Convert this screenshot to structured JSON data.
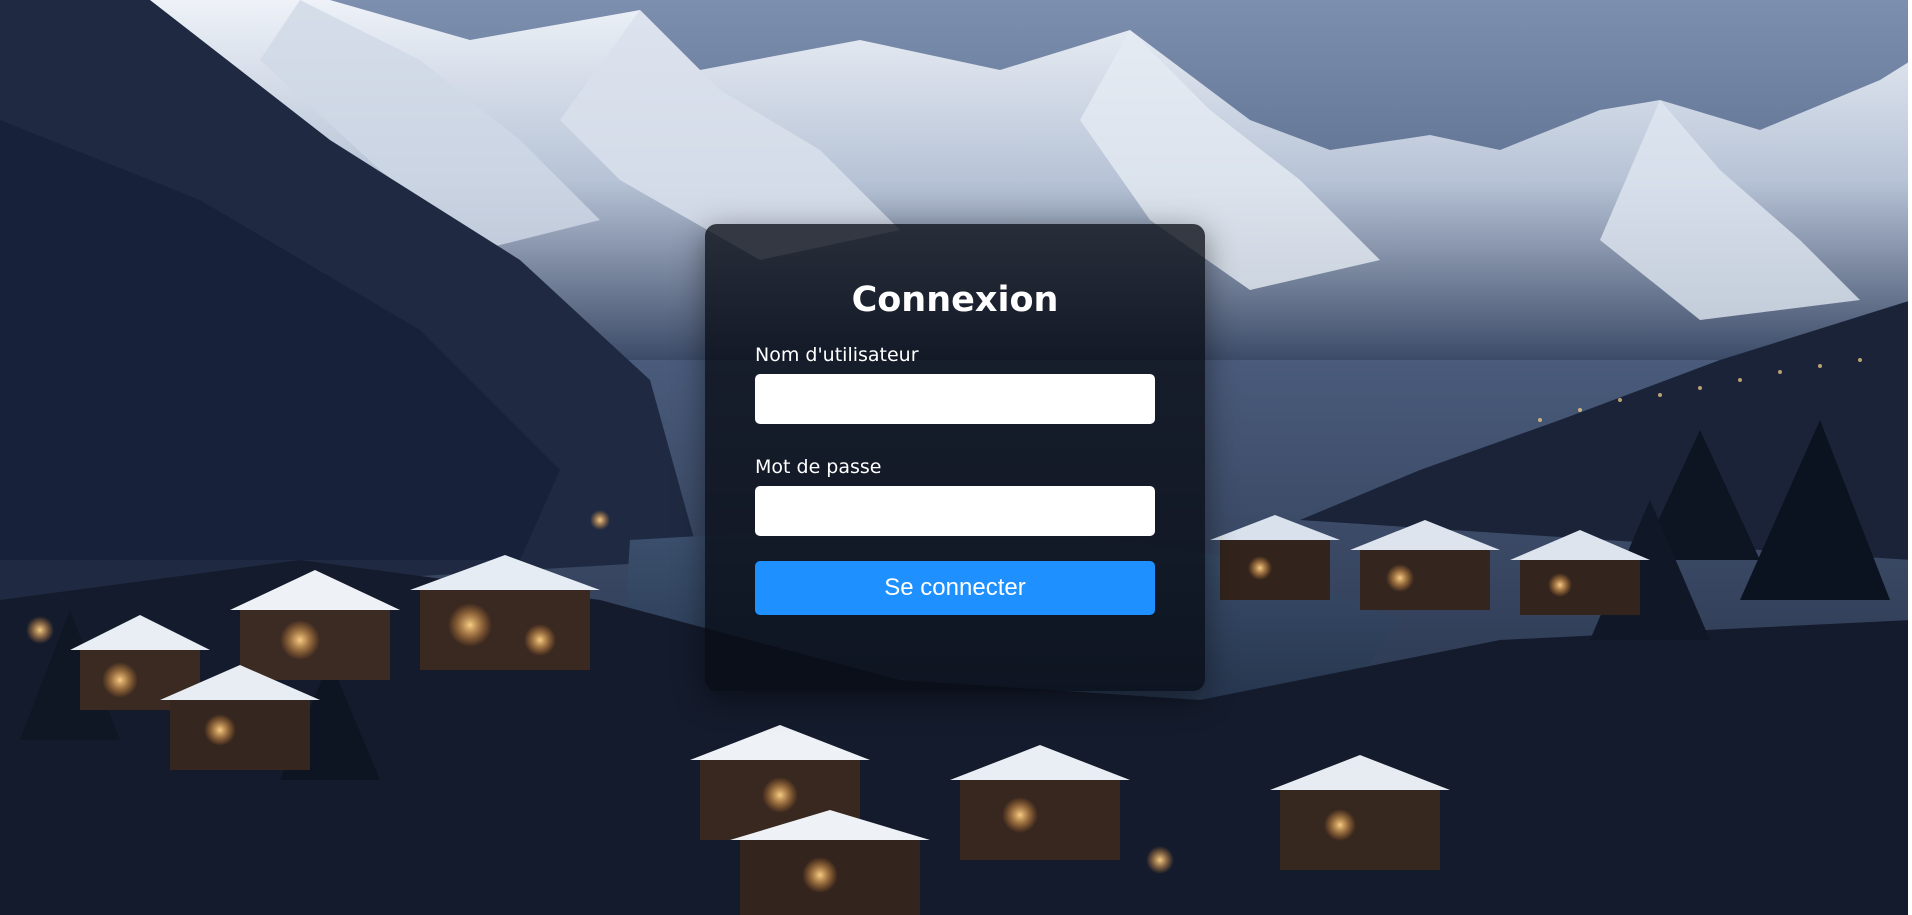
{
  "background": {
    "scene": "snowy-alpine-village-at-dusk",
    "sky_color": "#5d6f8f",
    "night_color": "#131a2b"
  },
  "login": {
    "title": "Connexion",
    "username_label": "Nom d'utilisateur",
    "username_value": "",
    "password_label": "Mot de passe",
    "password_value": "",
    "submit_label": "Se connecter"
  },
  "colors": {
    "card": "#080c14",
    "accent": "#1e90ff",
    "text": "#ffffff"
  }
}
